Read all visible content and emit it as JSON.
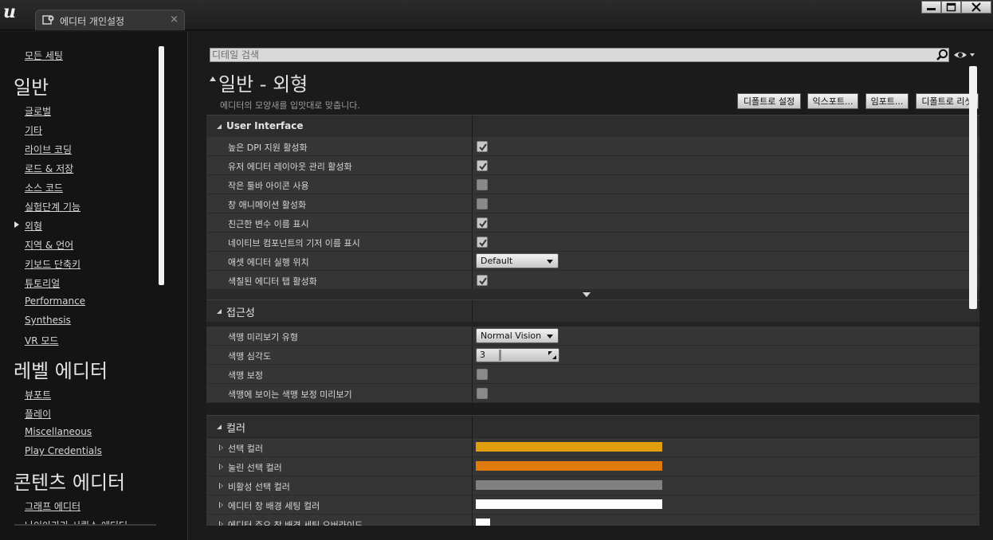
{
  "window": {
    "tab_title": "에디터 개인설정",
    "tab_close_glyph": "×"
  },
  "sidebar": {
    "all_settings": "모든 세팅",
    "categories": [
      {
        "title": "일반",
        "items": [
          "글로벌",
          "기타",
          "라이브 코딩",
          "로드 & 저장",
          "소스 코드",
          "실험단계 기능",
          "외형",
          "지역 & 언어",
          "키보드 단축키",
          "튜토리얼",
          "Performance",
          "Synthesis",
          "VR 모드"
        ]
      },
      {
        "title": "레벨 에디터",
        "items": [
          "뷰포트",
          "플레이",
          "Miscellaneous",
          "Play Credentials"
        ]
      },
      {
        "title": "콘텐츠 에디터",
        "items": [
          "그래프 에디터",
          "나이아가라 시퀀스 에디터"
        ]
      }
    ],
    "selected_item": "외형"
  },
  "search": {
    "placeholder": "디테일 검색"
  },
  "header": {
    "title": "일반 - 외형",
    "description": "에디터의 모양새를 입맛대로 맞춥니다.",
    "buttons": [
      "디폴트로 설정",
      "익스포트...",
      "임포트...",
      "디폴트로 리셋"
    ]
  },
  "sections": {
    "ui": {
      "title": "User Interface",
      "rows": [
        {
          "label": "높은 DPI 지원 활성화",
          "checked": true
        },
        {
          "label": "유저 에디터 레이아웃 관리 활성화",
          "checked": true
        },
        {
          "label": "작은 툴바 아이콘 사용",
          "checked": false
        },
        {
          "label": "창 애니메이션 활성화",
          "checked": false
        },
        {
          "label": "친근한 변수 이름 표시",
          "checked": true
        },
        {
          "label": "네이티브 컴포넌트의 기저 이름 표시",
          "checked": true
        },
        {
          "label": "애셋 에디터 실행 위치",
          "value": "Default"
        },
        {
          "label": "색칠된 에디터 탭 활성화",
          "checked": true
        }
      ]
    },
    "accessibility": {
      "title": "접근성",
      "rows": [
        {
          "label": "색맹 미리보기 유형",
          "value": "Normal Vision"
        },
        {
          "label": "색맹 심각도",
          "value": "3"
        },
        {
          "label": "색맹 보정",
          "checked": false
        },
        {
          "label": "색맹에 보이는 색맹 보정 미리보기",
          "checked": false
        }
      ]
    },
    "colors": {
      "title": "컬러",
      "rows": [
        {
          "label": "선택 컬러",
          "color": "#e09e0f"
        },
        {
          "label": "눌린 선택 컬러",
          "color": "#df7a0c"
        },
        {
          "label": "비활성 선택 컬러",
          "color": "#808080"
        },
        {
          "label": "에디터 창 배경 세팅 컬러",
          "color": "#ffffff"
        },
        {
          "label": "에디터 주요 창 배경 세팅 오버라이드",
          "color": "#ffffff"
        }
      ]
    }
  },
  "colors": {
    "accent_orange": "#e09e0f",
    "panel_bg": "#353535"
  }
}
